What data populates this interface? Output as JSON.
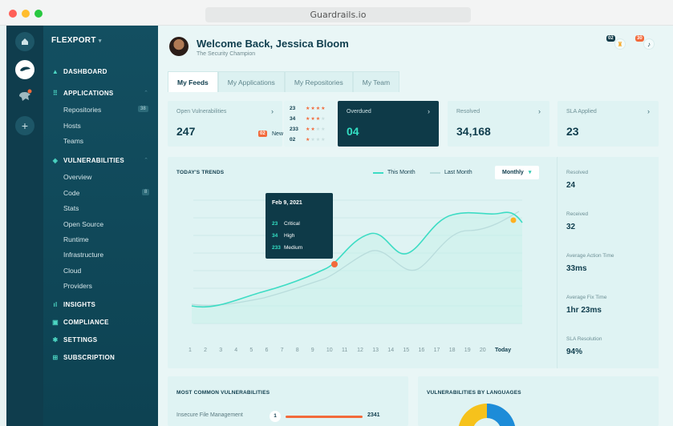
{
  "browser": {
    "url": "Guardrails.io",
    "dot_colors": [
      "#ff5f57",
      "#ffbd2e",
      "#28c840"
    ]
  },
  "sidebar": {
    "org": "FLEXPORT",
    "dashboard": "DASHBOARD",
    "applications": "APPLICATIONS",
    "app_items": [
      "Repositories",
      "Hosts",
      "Teams"
    ],
    "repositories_count": "38",
    "vulnerabilities": "VULNERABILITIES",
    "vuln_items": [
      "Overview",
      "Code",
      "Stats",
      "Open Source",
      "Runtime",
      "Infrastructure",
      "Cloud",
      "Providers"
    ],
    "code_count": "8",
    "insights": "INSIGHTS",
    "compliance": "COMPLIANCE",
    "settings": "SETTINGS",
    "subscription": "SUBSCRIPTION"
  },
  "header": {
    "welcome": "Welcome Back, Jessica Bloom",
    "role": "The Security Champion",
    "trophy_count": "02",
    "bell_count": "30"
  },
  "tabs": [
    "My Feeds",
    "My Applications",
    "My Repositories",
    "My Team"
  ],
  "stats": {
    "open_label": "Open Vulnerabilities",
    "open_value": "247",
    "new_count": "02",
    "new_label": "New",
    "severity": [
      {
        "count": "23",
        "stars": 4
      },
      {
        "count": "34",
        "stars": 3
      },
      {
        "count": "233",
        "stars": 2
      },
      {
        "count": "02",
        "stars": 1
      }
    ],
    "overdue_label": "Overdued",
    "overdue_value": "04",
    "resolved_label": "Resolved",
    "resolved_value": "34,168",
    "sla_label": "SLA Applied",
    "sla_value": "23"
  },
  "trends": {
    "title": "TODAY'S TRENDS",
    "legend_this": "This Month",
    "legend_last": "Last Month",
    "range": "Monthly",
    "x_labels": [
      "1",
      "2",
      "3",
      "4",
      "5",
      "6",
      "7",
      "8",
      "9",
      "10",
      "11",
      "12",
      "13",
      "14",
      "15",
      "16",
      "17",
      "18",
      "19",
      "20",
      "Today"
    ],
    "tooltip": {
      "date": "Feb 9, 2021",
      "rows": [
        {
          "value": "23",
          "label": "Critical"
        },
        {
          "value": "34",
          "label": "High"
        },
        {
          "value": "233",
          "label": "Medium"
        }
      ]
    },
    "colors": {
      "this_month": "#3ddcc4",
      "last_month": "#b9dcdc",
      "marker": "#f26a3b",
      "today_marker": "#ffb020"
    }
  },
  "side_stats": [
    {
      "label": "Resolved",
      "value": "24"
    },
    {
      "label": "Received",
      "value": "32"
    },
    {
      "label": "Average Action Time",
      "value": "33ms"
    },
    {
      "label": "Average Fix Time",
      "value": "1hr 23ms"
    },
    {
      "label": "SLA Resolution",
      "value": "94%"
    }
  ],
  "bottom": {
    "common_title": "MOST COMMON VULNERABILITIES",
    "common_item": {
      "name": "Insecure File Management",
      "rank": "1",
      "value": "2341"
    },
    "languages_title": "VULNERABILITIES BY LANGUAGES"
  }
}
